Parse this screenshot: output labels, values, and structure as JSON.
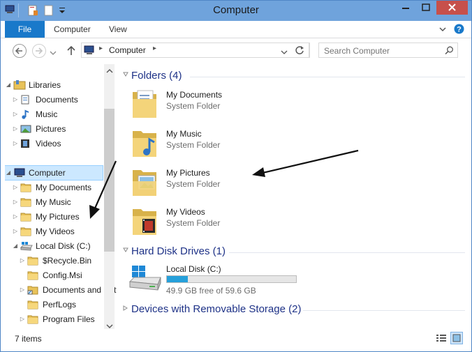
{
  "window": {
    "title": "Computer"
  },
  "ribbon": {
    "tabs": [
      "File",
      "Computer",
      "View"
    ]
  },
  "address": {
    "crumbs": [
      "Computer"
    ],
    "search_placeholder": "Search Computer"
  },
  "nav": {
    "items": [
      {
        "label": "Libraries",
        "level": 0,
        "expander": "open",
        "icon": "libraries-icon"
      },
      {
        "label": "Documents",
        "level": 1,
        "expander": "closed",
        "icon": "documents-icon"
      },
      {
        "label": "Music",
        "level": 1,
        "expander": "closed",
        "icon": "music-icon"
      },
      {
        "label": "Pictures",
        "level": 1,
        "expander": "closed",
        "icon": "pictures-icon"
      },
      {
        "label": "Videos",
        "level": 1,
        "expander": "closed",
        "icon": "videos-icon"
      },
      {
        "label": "Computer",
        "level": 0,
        "expander": "open",
        "icon": "computer-icon",
        "selected": true
      },
      {
        "label": "My Documents",
        "level": 1,
        "expander": "closed",
        "icon": "folder-icon"
      },
      {
        "label": "My Music",
        "level": 1,
        "expander": "closed",
        "icon": "folder-icon"
      },
      {
        "label": "My Pictures",
        "level": 1,
        "expander": "closed",
        "icon": "folder-icon"
      },
      {
        "label": "My Videos",
        "level": 1,
        "expander": "closed",
        "icon": "folder-icon"
      },
      {
        "label": "Local Disk (C:)",
        "level": 1,
        "expander": "open",
        "icon": "disk-icon"
      },
      {
        "label": "$Recycle.Bin",
        "level": 2,
        "expander": "closed",
        "icon": "folder-icon"
      },
      {
        "label": "Config.Msi",
        "level": 2,
        "expander": "none",
        "icon": "folder-icon"
      },
      {
        "label": "Documents and Settings",
        "level": 2,
        "expander": "closed",
        "icon": "folder-link-icon"
      },
      {
        "label": "PerfLogs",
        "level": 2,
        "expander": "none",
        "icon": "folder-icon"
      },
      {
        "label": "Program Files",
        "level": 2,
        "expander": "closed",
        "icon": "folder-icon"
      }
    ]
  },
  "groups": {
    "folders": {
      "header": "Folders (4)",
      "items": [
        {
          "name": "My Documents",
          "type": "System Folder",
          "icon": "documents-folder-icon"
        },
        {
          "name": "My Music",
          "type": "System Folder",
          "icon": "music-folder-icon"
        },
        {
          "name": "My Pictures",
          "type": "System Folder",
          "icon": "pictures-folder-icon"
        },
        {
          "name": "My Videos",
          "type": "System Folder",
          "icon": "videos-folder-icon"
        }
      ]
    },
    "drives": {
      "header": "Hard Disk Drives (1)",
      "items": [
        {
          "name": "Local Disk (C:)",
          "free_text": "49.9 GB free of 59.6 GB",
          "used_fraction": 0.163
        }
      ]
    },
    "removable": {
      "header": "Devices with Removable Storage (2)"
    }
  },
  "status": {
    "item_count": "7 items"
  },
  "colors": {
    "accent": "#1979ca",
    "title_bg": "#6fa3dc",
    "group_header": "#1e3287",
    "close": "#c7504b",
    "drive_bar": "#26a0da"
  }
}
